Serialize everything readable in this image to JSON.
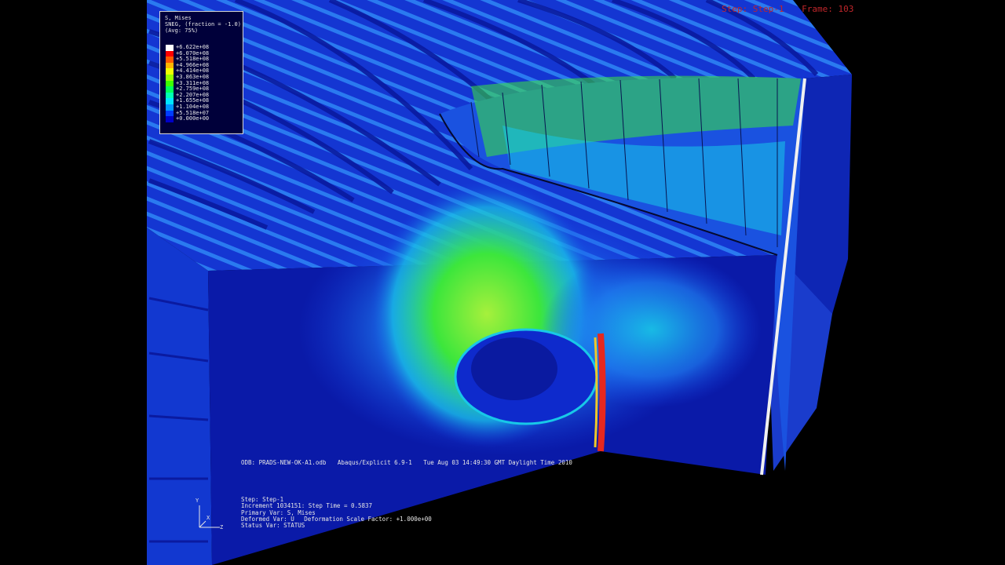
{
  "viewport_header": {
    "step": "Step: Step-1",
    "frame": "Frame: 103"
  },
  "legend": {
    "title_lines": [
      "S, Mises",
      "SNEG, (fraction = -1.0)",
      "(Avg: 75%)"
    ],
    "values": [
      "+6.622e+08",
      "+6.070e+08",
      "+5.518e+08",
      "+4.966e+08",
      "+4.414e+08",
      "+3.863e+08",
      "+3.311e+08",
      "+2.759e+08",
      "+2.207e+08",
      "+1.655e+08",
      "+1.104e+08",
      "+5.518e+07",
      "+0.000e+00"
    ],
    "colors": [
      "#ffffff",
      "#ff0000",
      "#ff5a00",
      "#ffb400",
      "#f0ff00",
      "#96ff00",
      "#3cff00",
      "#00ff5a",
      "#00ffb4",
      "#00e6ff",
      "#0096ff",
      "#003cff",
      "#0000c8",
      "#000000"
    ]
  },
  "odb_info": {
    "odb": "ODB: PRADS-NEW-OK-A1.odb",
    "solver": "Abaqus/Explicit 6.9-1",
    "date": "Tue Aug 03 14:49:30 GMT Daylight Time 2010"
  },
  "status_info": {
    "step": "Step: Step-1",
    "increment": "Increment   1034151: Step Time =    0.5837",
    "primary_var": "Primary Var: S, Mises",
    "deformed_var": "Deformed Var: U",
    "scale_factor": "Deformation Scale Factor: +1.000e+00",
    "status_var": "Status Var: STATUS"
  },
  "triad": {
    "y": "Y",
    "z": "Z",
    "x": "X"
  },
  "scene_colors": {
    "deep_blue": "#0a1aa8",
    "mid_blue": "#1540e6",
    "light_blue": "#1e7cf0",
    "cyan": "#18c8e8",
    "green": "#3ce63c",
    "yellow_green": "#a6f03c",
    "red": "#e6281e"
  }
}
